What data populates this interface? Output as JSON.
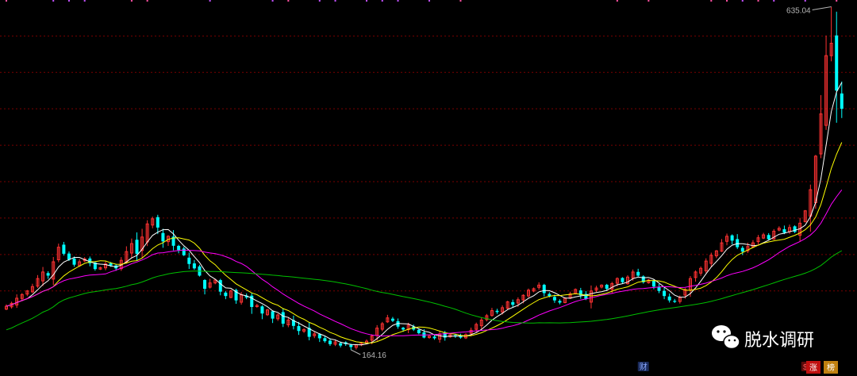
{
  "chart_data": {
    "type": "candlestick",
    "annotations": {
      "high": "635.04",
      "low": "164.16"
    },
    "markers": [
      {
        "label": "财",
        "bar": 122
      },
      {
        "label": "$",
        "bar": 153
      }
    ],
    "corner_badges": [
      "涨",
      "榜"
    ],
    "watermark": "脱水调研",
    "ylim": [
      150,
      640
    ],
    "hlines": [
      595,
      545,
      495,
      445,
      395,
      345,
      295,
      245
    ],
    "colors": {
      "up": "#ff3232",
      "down": "#00ffff",
      "ma5": "#ffffff",
      "ma10": "#ffff00",
      "ma20": "#ff00ff",
      "ma60": "#00c000",
      "grid": "#7a0000"
    },
    "close": [
      224,
      228,
      235,
      240,
      245,
      251,
      262,
      271,
      266,
      285,
      305,
      296,
      288,
      281,
      285,
      289,
      283,
      275,
      277,
      282,
      280,
      276,
      287,
      299,
      310,
      296,
      319,
      337,
      344,
      332,
      313,
      320,
      307,
      301,
      294,
      282,
      276,
      266,
      248,
      256,
      260,
      244,
      238,
      245,
      232,
      240,
      236,
      223,
      225,
      214,
      219,
      207,
      212,
      200,
      205,
      197,
      190,
      192,
      182,
      186,
      180,
      176,
      172,
      175,
      170,
      172,
      168,
      171,
      174,
      176,
      183,
      194,
      200,
      208,
      204,
      196,
      192,
      198,
      192,
      187,
      181,
      183,
      180,
      186,
      181,
      185,
      183,
      181,
      185,
      191,
      199,
      205,
      211,
      218,
      216,
      222,
      230,
      226,
      233,
      239,
      246,
      248,
      253,
      242,
      238,
      232,
      229,
      235,
      241,
      247,
      239,
      234,
      245,
      249,
      253,
      248,
      255,
      262,
      257,
      264,
      271,
      266,
      257,
      260,
      251,
      245,
      238,
      232,
      230,
      236,
      247,
      262,
      271,
      276,
      286,
      294,
      300,
      311,
      320,
      314,
      305,
      299,
      306,
      311,
      318,
      322,
      316,
      327,
      331,
      325,
      332,
      326,
      338,
      355,
      384,
      430,
      488,
      568,
      585,
      520,
      495
    ]
  }
}
